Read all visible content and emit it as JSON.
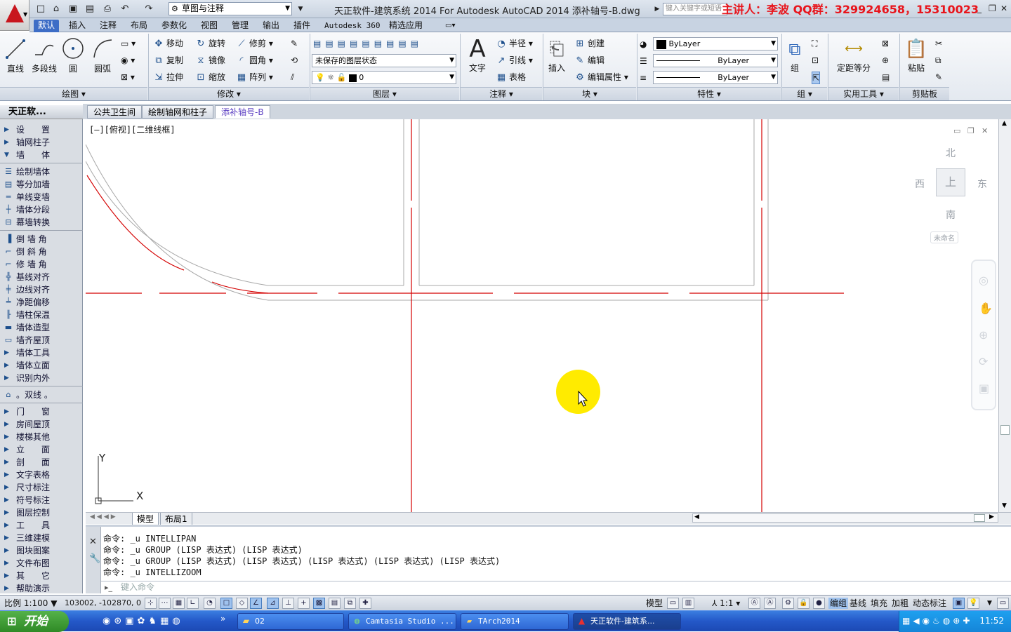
{
  "titlebar": {
    "window_title": "天正软件-建筑系统 2014  For Autodesk AutoCAD 2014    添补轴号-B.dwg",
    "workspace": "草图与注释",
    "search_placeholder": "键入关键字或短语",
    "lecturer_text": "主讲人：李波    QQ群：329924658，15310023",
    "minimize": "_",
    "restore": "❐",
    "close": "✕"
  },
  "ribbon_tabs": [
    "默认",
    "插入",
    "注释",
    "布局",
    "参数化",
    "视图",
    "管理",
    "输出",
    "插件",
    "Autodesk 360",
    "精选应用"
  ],
  "ribbon": {
    "draw": {
      "title": "绘图",
      "line": "直线",
      "polyline": "多段线",
      "circle": "圆",
      "arc": "圆弧"
    },
    "modify": {
      "title": "修改",
      "move": "移动",
      "rotate": "旋转",
      "trim": "修剪",
      "copy": "复制",
      "mirror": "镜像",
      "fillet": "圆角",
      "stretch": "拉伸",
      "scale": "缩放",
      "array": "阵列"
    },
    "layers": {
      "title": "图层",
      "state": "未保存的图层状态",
      "current_layer": "0"
    },
    "annotation": {
      "title": "注释",
      "text": "文字",
      "radius": "半径",
      "leader": "引线",
      "table": "表格"
    },
    "block": {
      "title": "块",
      "insert": "插入",
      "create": "创建",
      "edit": "编辑",
      "edit_attr": "编辑属性"
    },
    "properties": {
      "title": "特性",
      "color": "ByLayer",
      "linetype": "ByLayer",
      "lineweight": "ByLayer"
    },
    "groups": {
      "title": "组",
      "group": "组"
    },
    "utilities": {
      "title": "实用工具",
      "measure": "定距等分"
    },
    "clipboard": {
      "title": "剪贴板",
      "paste": "粘贴"
    }
  },
  "palette": {
    "title": "天正软...",
    "items": [
      {
        "label": "设　　置",
        "kind": "cat"
      },
      {
        "label": "轴网柱子",
        "kind": "cat"
      },
      {
        "label": "墙　　体",
        "kind": "open"
      },
      {
        "label": "绘制墙体",
        "kind": "cmd"
      },
      {
        "label": "等分加墙",
        "kind": "cmd"
      },
      {
        "label": "单线变墙",
        "kind": "cmd"
      },
      {
        "label": "墙体分段",
        "kind": "cmd"
      },
      {
        "label": "幕墙转换",
        "kind": "cmd"
      },
      {
        "label": "倒 墙 角",
        "kind": "cmd"
      },
      {
        "label": "倒 斜 角",
        "kind": "cmd"
      },
      {
        "label": "修 墙 角",
        "kind": "cmd"
      },
      {
        "label": "基线对齐",
        "kind": "cmd"
      },
      {
        "label": "边线对齐",
        "kind": "cmd"
      },
      {
        "label": "净距偏移",
        "kind": "cmd"
      },
      {
        "label": "墙柱保温",
        "kind": "cmd"
      },
      {
        "label": "墙体造型",
        "kind": "cmd"
      },
      {
        "label": "墙齐屋顶",
        "kind": "cmd"
      },
      {
        "label": "墙体工具",
        "kind": "cat"
      },
      {
        "label": "墙体立面",
        "kind": "cat"
      },
      {
        "label": "识别内外",
        "kind": "cat"
      },
      {
        "label": "。双线 。",
        "kind": "cmd"
      },
      {
        "label": "门　　窗",
        "kind": "cat"
      },
      {
        "label": "房间屋顶",
        "kind": "cat"
      },
      {
        "label": "楼梯其他",
        "kind": "cat"
      },
      {
        "label": "立　　面",
        "kind": "cat"
      },
      {
        "label": "剖　　面",
        "kind": "cat"
      },
      {
        "label": "文字表格",
        "kind": "cat"
      },
      {
        "label": "尺寸标注",
        "kind": "cat"
      },
      {
        "label": "符号标注",
        "kind": "cat"
      },
      {
        "label": "图层控制",
        "kind": "cat"
      },
      {
        "label": "工　　具",
        "kind": "cat"
      },
      {
        "label": "三维建模",
        "kind": "cat"
      },
      {
        "label": "图块图案",
        "kind": "cat"
      },
      {
        "label": "文件布图",
        "kind": "cat"
      },
      {
        "label": "其　　它",
        "kind": "cat"
      },
      {
        "label": "帮助演示",
        "kind": "cat"
      }
    ]
  },
  "doc_tabs": [
    "公共卫生间",
    "绘制轴网和柱子",
    "添补轴号-B"
  ],
  "viewport": {
    "label": "[—][俯视][二维线框]",
    "viewcube": {
      "north": "北",
      "south": "南",
      "east": "东",
      "west": "西",
      "top": "上",
      "ucs": "未命名"
    },
    "ucs_x": "X",
    "ucs_y": "Y"
  },
  "layout_tabs": [
    "模型",
    "布局1"
  ],
  "command": {
    "history": [
      "命令: _u INTELLIPAN",
      "命令: _u GROUP (LISP 表达式) (LISP 表达式)",
      "命令: _u GROUP (LISP 表达式) (LISP 表达式) (LISP 表达式) (LISP 表达式) (LISP 表达式)",
      "命令: _u INTELLIZOOM"
    ],
    "placeholder": "键入命令"
  },
  "statusbar": {
    "scale": "比例 1:100",
    "coords": "103002, -102870, 0",
    "model": "模型",
    "annoscale": "1:1",
    "toggles": [
      "编组",
      "基线",
      "填充",
      "加粗",
      "动态标注"
    ]
  },
  "taskbar": {
    "start": "开始",
    "tasks": [
      "02",
      "Camtasia Studio ...",
      "TArch2014",
      "天正软件-建筑系..."
    ],
    "clock": "11:52"
  },
  "colors": {
    "axis_red": "#d40000",
    "wall_gray": "#a8a8a8",
    "ribbon_active_tab": "#3d6dc6",
    "cursor_highlight": "#ffeb00"
  }
}
